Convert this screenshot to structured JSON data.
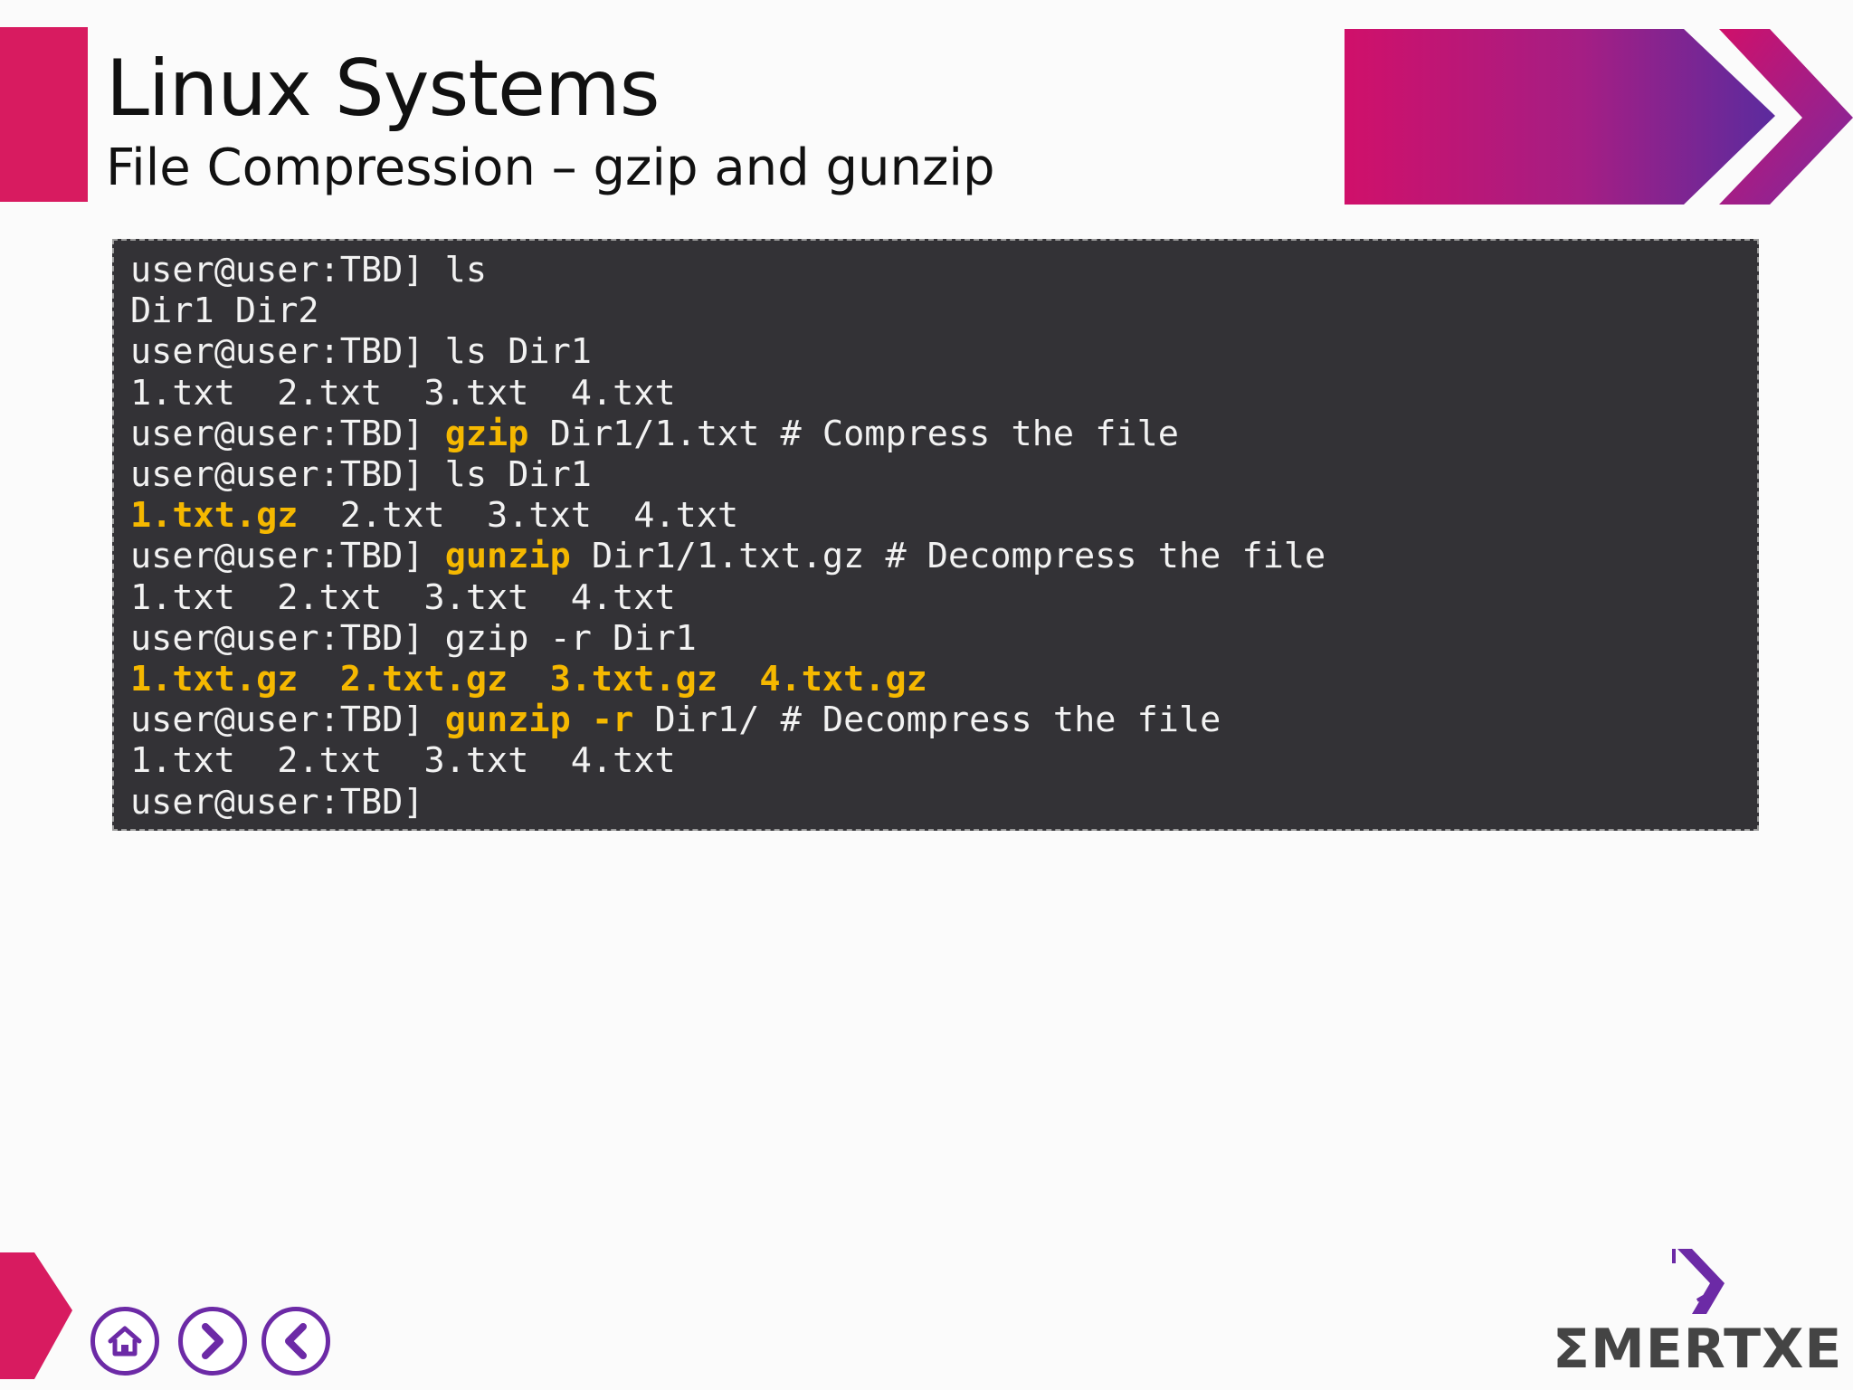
{
  "header": {
    "title": "Linux Systems",
    "subtitle": "File Compression – gzip and gunzip"
  },
  "terminal": {
    "lines": [
      [
        {
          "t": "user@user:TBD] ls",
          "hl": false
        }
      ],
      [
        {
          "t": "Dir1 Dir2",
          "hl": false
        }
      ],
      [
        {
          "t": "user@user:TBD] ls Dir1",
          "hl": false
        }
      ],
      [
        {
          "t": "1.txt  2.txt  3.txt  4.txt",
          "hl": false
        }
      ],
      [
        {
          "t": "user@user:TBD] ",
          "hl": false
        },
        {
          "t": "gzip",
          "hl": true
        },
        {
          "t": " Dir1/1.txt # Compress the file",
          "hl": false
        }
      ],
      [
        {
          "t": "user@user:TBD] ls Dir1",
          "hl": false
        }
      ],
      [
        {
          "t": "1.txt.gz",
          "hl": true
        },
        {
          "t": "  2.txt  3.txt  4.txt",
          "hl": false
        }
      ],
      [
        {
          "t": "user@user:TBD] ",
          "hl": false
        },
        {
          "t": "gunzip",
          "hl": true
        },
        {
          "t": " Dir1/1.txt.gz # Decompress the file",
          "hl": false
        }
      ],
      [
        {
          "t": "1.txt  2.txt  3.txt  4.txt",
          "hl": false
        }
      ],
      [
        {
          "t": "user@user:TBD] gzip -r Dir1",
          "hl": false
        }
      ],
      [
        {
          "t": "1.txt.gz  2.txt.gz  3.txt.gz  4.txt.gz",
          "hl": true
        }
      ],
      [
        {
          "t": "user@user:TBD] ",
          "hl": false
        },
        {
          "t": "gunzip -r",
          "hl": true
        },
        {
          "t": " Dir1/ # Decompress the file",
          "hl": false
        }
      ],
      [
        {
          "t": "1.txt  2.txt  3.txt  4.txt",
          "hl": false
        }
      ],
      [
        {
          "t": "user@user:TBD]",
          "hl": false
        }
      ]
    ]
  },
  "nav": {
    "home_icon": "home-icon",
    "next_icon": "chevron-right-icon",
    "prev_icon": "chevron-left-icon"
  },
  "logo": {
    "text": "ΣMERTXE"
  },
  "colors": {
    "accent_pink": "#d81b60",
    "accent_purple": "#6c2aa6",
    "highlight": "#f5b800",
    "terminal_bg": "#333236"
  }
}
